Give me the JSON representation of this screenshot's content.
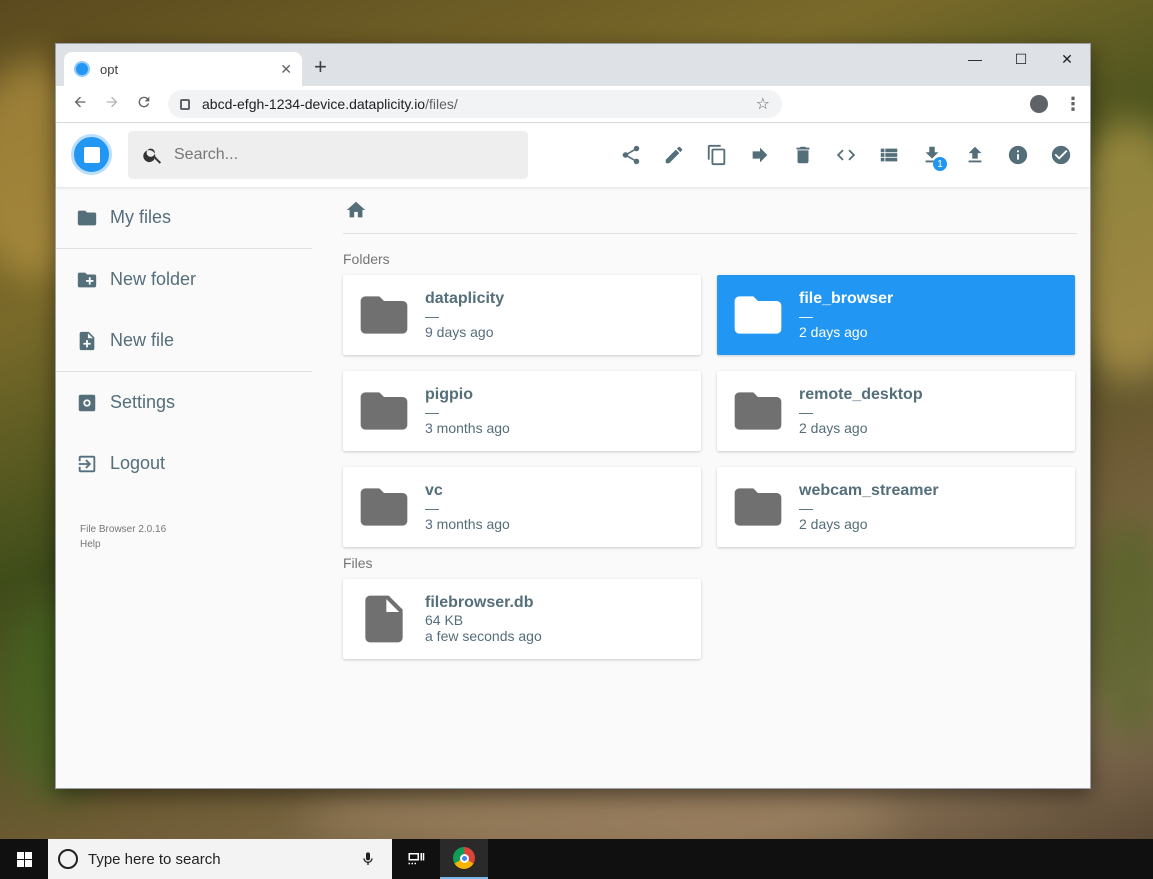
{
  "browser": {
    "tab_title": "opt",
    "tab_close": "✕",
    "new_tab": "+",
    "window_controls": {
      "minimize": "—",
      "maximize": "☐",
      "close": "✕"
    },
    "url_host": "abcd-efgh-1234-device.dataplicity.io",
    "url_path": "/files/"
  },
  "app": {
    "search_placeholder": "Search...",
    "download_badge": "1",
    "actions": [
      "share",
      "rename",
      "copy",
      "move",
      "delete",
      "switch-view",
      "list-view",
      "download",
      "upload",
      "info",
      "select-multiple"
    ]
  },
  "sidebar": {
    "items": [
      {
        "label": "My files",
        "icon": "folder-icon"
      },
      {
        "label": "New folder",
        "icon": "create-folder-icon"
      },
      {
        "label": "New file",
        "icon": "note-add-icon"
      },
      {
        "label": "Settings",
        "icon": "settings-icon"
      },
      {
        "label": "Logout",
        "icon": "logout-icon"
      }
    ],
    "version": "File Browser 2.0.16",
    "help": "Help"
  },
  "main": {
    "folders_title": "Folders",
    "files_title": "Files",
    "folders": [
      {
        "name": "dataplicity",
        "size": "—",
        "modified": "9 days ago",
        "selected": false
      },
      {
        "name": "file_browser",
        "size": "—",
        "modified": "2 days ago",
        "selected": true
      },
      {
        "name": "pigpio",
        "size": "—",
        "modified": "3 months ago",
        "selected": false
      },
      {
        "name": "remote_desktop",
        "size": "—",
        "modified": "2 days ago",
        "selected": false
      },
      {
        "name": "vc",
        "size": "—",
        "modified": "3 months ago",
        "selected": false
      },
      {
        "name": "webcam_streamer",
        "size": "—",
        "modified": "2 days ago",
        "selected": false
      }
    ],
    "files": [
      {
        "name": "filebrowser.db",
        "size": "64 KB",
        "modified": "a few seconds ago"
      }
    ]
  },
  "taskbar": {
    "search_placeholder": "Type here to search"
  },
  "colors": {
    "accent": "#2196f3",
    "icon": "#546e7a",
    "folder": "#707070"
  }
}
